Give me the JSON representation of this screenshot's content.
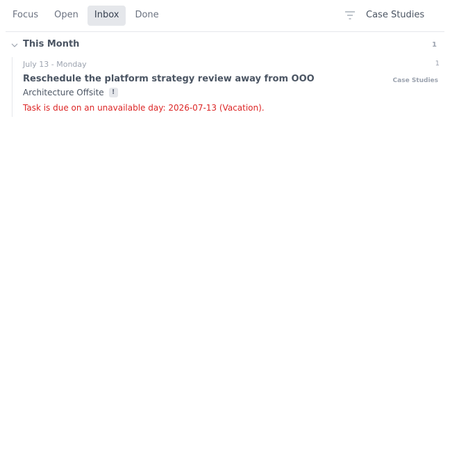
{
  "tabs": [
    {
      "label": "Focus",
      "active": false
    },
    {
      "label": "Open",
      "active": false
    },
    {
      "label": "Inbox",
      "active": true
    },
    {
      "label": "Done",
      "active": false
    }
  ],
  "filter": {
    "icon": "filter-icon"
  },
  "project_filter": {
    "label": "Case Studies"
  },
  "group": {
    "title": "This Month",
    "count": "1",
    "icon": "chevron-down-icon"
  },
  "day": {
    "label": "July 13 - Monday",
    "count": "1"
  },
  "task": {
    "title": "Reschedule the platform strategy review away from OOO",
    "project": "Case Studies",
    "context": "Architecture Offsite",
    "badge": "!",
    "warning": "Task is due on an unavailable day: 2026-07-13 (Vacation)."
  },
  "colors": {
    "accent_active_tab": "#e5e7eb",
    "warning": "#dc2626",
    "muted": "#9ca3af"
  }
}
